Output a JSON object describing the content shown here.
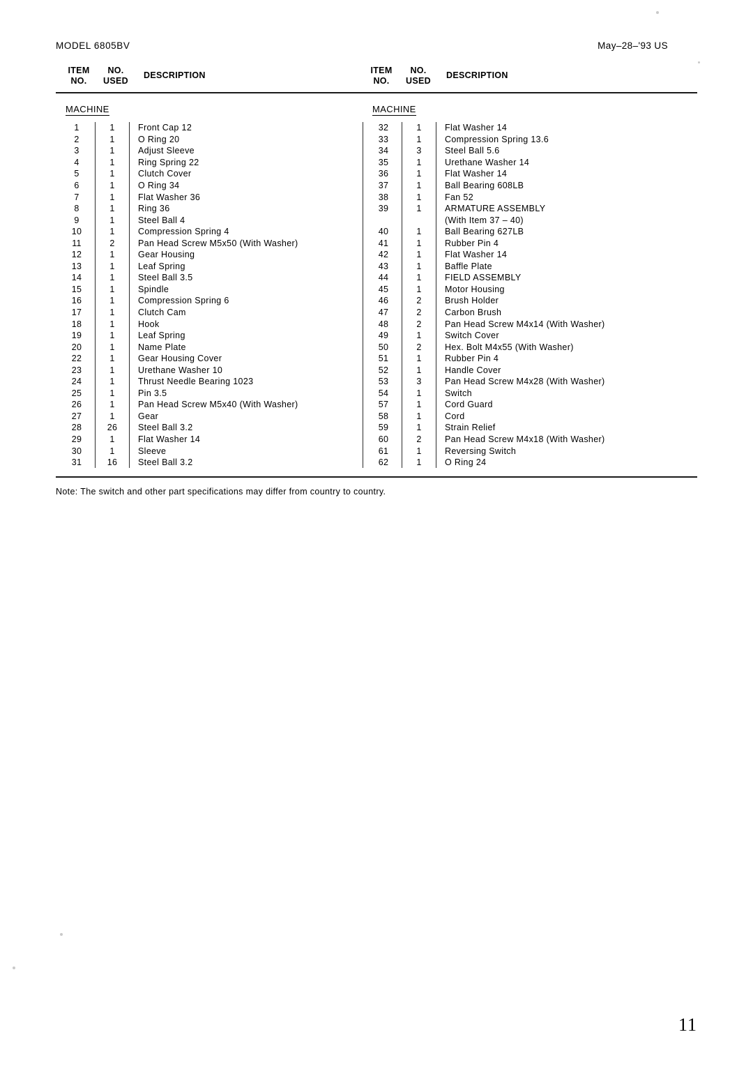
{
  "header": {
    "model": "MODEL 6805BV",
    "date": "May–28–'93 US"
  },
  "column_headers": {
    "item_no": "ITEM\nNO.",
    "item_no_line1": "ITEM",
    "item_no_line2": "NO.",
    "no_used_line1": "NO.",
    "no_used_line2": "USED",
    "description": "DESCRIPTION"
  },
  "section_title": "MACHINE",
  "note": "Note: The switch and other part specifications may differ from country to country.",
  "page_number": "11",
  "table": {
    "left_rows": [
      {
        "item": "1",
        "used": "1",
        "desc": "Front Cap 12"
      },
      {
        "item": "2",
        "used": "1",
        "desc": "O Ring 20"
      },
      {
        "item": "3",
        "used": "1",
        "desc": "Adjust Sleeve"
      },
      {
        "item": "4",
        "used": "1",
        "desc": "Ring Spring 22"
      },
      {
        "item": "5",
        "used": "1",
        "desc": "Clutch Cover"
      },
      {
        "item": "6",
        "used": "1",
        "desc": "O Ring 34"
      },
      {
        "item": "7",
        "used": "1",
        "desc": "Flat Washer 36"
      },
      {
        "item": "8",
        "used": "1",
        "desc": "Ring 36"
      },
      {
        "item": "9",
        "used": "1",
        "desc": "Steel Ball 4"
      },
      {
        "item": "10",
        "used": "1",
        "desc": "Compression Spring 4"
      },
      {
        "item": "11",
        "used": "2",
        "desc": "Pan Head Screw M5x50 (With Washer)"
      },
      {
        "item": "12",
        "used": "1",
        "desc": "Gear Housing"
      },
      {
        "item": "13",
        "used": "1",
        "desc": "Leaf Spring"
      },
      {
        "item": "14",
        "used": "1",
        "desc": "Steel Ball 3.5"
      },
      {
        "item": "15",
        "used": "1",
        "desc": "Spindle"
      },
      {
        "item": "16",
        "used": "1",
        "desc": "Compression Spring 6"
      },
      {
        "item": "17",
        "used": "1",
        "desc": "Clutch Cam"
      },
      {
        "item": "18",
        "used": "1",
        "desc": "Hook"
      },
      {
        "item": "19",
        "used": "1",
        "desc": "Leaf Spring"
      },
      {
        "item": "20",
        "used": "1",
        "desc": "Name Plate"
      },
      {
        "item": "22",
        "used": "1",
        "desc": "Gear Housing Cover"
      },
      {
        "item": "23",
        "used": "1",
        "desc": "Urethane Washer 10"
      },
      {
        "item": "24",
        "used": "1",
        "desc": "Thrust Needle Bearing 1023"
      },
      {
        "item": "25",
        "used": "1",
        "desc": "Pin 3.5"
      },
      {
        "item": "26",
        "used": "1",
        "desc": "Pan Head Screw M5x40 (With Washer)"
      },
      {
        "item": "27",
        "used": "1",
        "desc": "Gear"
      },
      {
        "item": "28",
        "used": "26",
        "desc": "Steel Ball 3.2"
      },
      {
        "item": "29",
        "used": "1",
        "desc": "Flat Washer 14"
      },
      {
        "item": "30",
        "used": "1",
        "desc": "Sleeve"
      },
      {
        "item": "31",
        "used": "16",
        "desc": "Steel Ball 3.2"
      }
    ],
    "right_rows": [
      {
        "item": "32",
        "used": "1",
        "desc": "Flat Washer 14"
      },
      {
        "item": "33",
        "used": "1",
        "desc": "Compression Spring 13.6"
      },
      {
        "item": "34",
        "used": "3",
        "desc": "Steel Ball 5.6"
      },
      {
        "item": "35",
        "used": "1",
        "desc": "Urethane Washer 14"
      },
      {
        "item": "36",
        "used": "1",
        "desc": "Flat Washer 14"
      },
      {
        "item": "37",
        "used": "1",
        "desc": "Ball Bearing 608LB"
      },
      {
        "item": "38",
        "used": "1",
        "desc": "Fan 52"
      },
      {
        "item": "39",
        "used": "1",
        "desc": "ARMATURE ASSEMBLY"
      },
      {
        "item": "",
        "used": "",
        "desc": "(With Item 37 – 40)",
        "continuation": true
      },
      {
        "item": "40",
        "used": "1",
        "desc": "Ball Bearing 627LB"
      },
      {
        "item": "41",
        "used": "1",
        "desc": "Rubber Pin 4"
      },
      {
        "item": "42",
        "used": "1",
        "desc": "Flat Washer 14"
      },
      {
        "item": "43",
        "used": "1",
        "desc": "Baffle Plate"
      },
      {
        "item": "44",
        "used": "1",
        "desc": "FIELD ASSEMBLY"
      },
      {
        "item": "45",
        "used": "1",
        "desc": "Motor Housing"
      },
      {
        "item": "46",
        "used": "2",
        "desc": "Brush Holder"
      },
      {
        "item": "47",
        "used": "2",
        "desc": "Carbon Brush"
      },
      {
        "item": "48",
        "used": "2",
        "desc": "Pan Head Screw M4x14 (With Washer)"
      },
      {
        "item": "49",
        "used": "1",
        "desc": "Switch Cover"
      },
      {
        "item": "50",
        "used": "2",
        "desc": "Hex. Bolt M4x55 (With Washer)"
      },
      {
        "item": "51",
        "used": "1",
        "desc": "Rubber Pin 4"
      },
      {
        "item": "52",
        "used": "1",
        "desc": "Handle Cover"
      },
      {
        "item": "53",
        "used": "3",
        "desc": "Pan Head Screw M4x28 (With Washer)"
      },
      {
        "item": "54",
        "used": "1",
        "desc": "Switch"
      },
      {
        "item": "57",
        "used": "1",
        "desc": "Cord Guard"
      },
      {
        "item": "58",
        "used": "1",
        "desc": "Cord"
      },
      {
        "item": "59",
        "used": "1",
        "desc": "Strain Relief"
      },
      {
        "item": "60",
        "used": "2",
        "desc": "Pan Head Screw M4x18 (With Washer)"
      },
      {
        "item": "61",
        "used": "1",
        "desc": "Reversing Switch"
      },
      {
        "item": "62",
        "used": "1",
        "desc": "O Ring 24"
      }
    ]
  }
}
